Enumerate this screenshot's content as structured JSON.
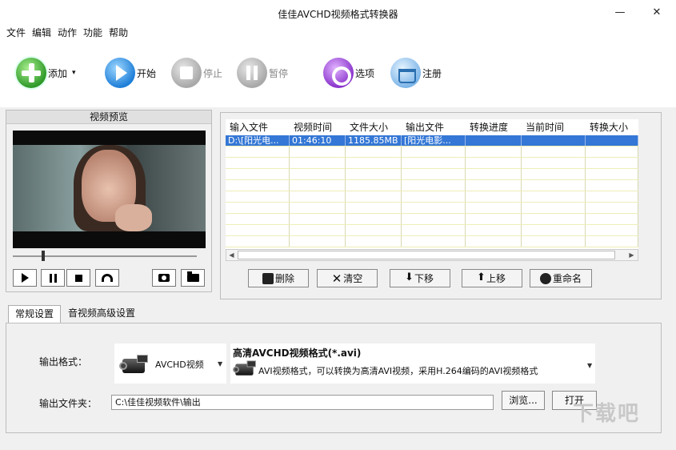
{
  "window": {
    "title": "佳佳AVCHD视频格式转换器",
    "minimize": "—",
    "close": "✕"
  },
  "menu": [
    "文件",
    "编辑",
    "动作",
    "功能",
    "帮助"
  ],
  "toolbar": {
    "add": "添加",
    "add_arrow": "▾",
    "start": "开始",
    "stop": "停止",
    "pause": "暂停",
    "options": "选项",
    "register": "注册"
  },
  "preview": {
    "title": "视频预览"
  },
  "file_table": {
    "columns": [
      "输入文件",
      "视频时间",
      "文件大小",
      "输出文件",
      "转换进度",
      "当前时间",
      "转换大小"
    ],
    "rows": [
      [
        "D:\\[阳光电...",
        "01:46:10",
        "1185.85MB",
        "[阳光电影...",
        "",
        "",
        ""
      ]
    ]
  },
  "list_actions": {
    "delete": "删除",
    "clear": "清空",
    "move_down": "下移",
    "move_up": "上移",
    "rename": "重命名"
  },
  "tabs": [
    "常规设置",
    "音视频高级设置"
  ],
  "settings": {
    "output_format_label": "输出格式：",
    "format_category": "AVCHD视频",
    "format_name": "高清AVCHD视频格式(*.avi)",
    "format_desc": "AVI视频格式，可以转换为高清AVI视频，采用H.264编码的AVI视频格式",
    "output_folder_label": "输出文件夹：",
    "output_folder": "C:\\佳佳视频软件\\输出",
    "browse": "浏览...",
    "open": "打开"
  },
  "watermark": "下载吧"
}
